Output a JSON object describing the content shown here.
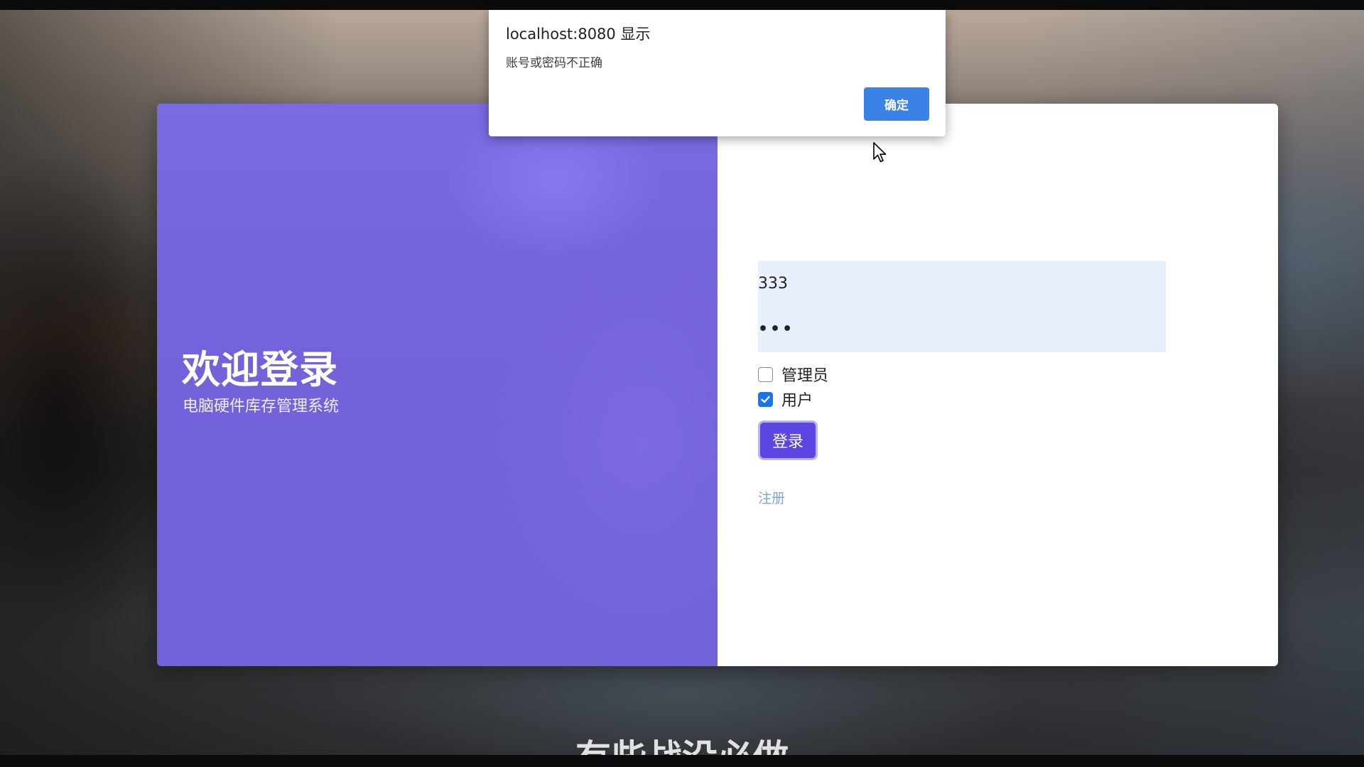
{
  "login": {
    "title": "欢迎登录",
    "subtitle": "电脑硬件库存管理系统",
    "username_value": "333",
    "password_value": "•••",
    "roles": [
      {
        "label": "管理员",
        "checked": false
      },
      {
        "label": "用户",
        "checked": true
      }
    ],
    "login_button": "登录",
    "register_link": "注册"
  },
  "alert": {
    "title": "localhost:8080 显示",
    "message": "账号或密码不正确",
    "ok_button": "确定"
  },
  "caption": {
    "text": "有些战没必做"
  },
  "colors": {
    "panel_purple": "#7363dc",
    "login_button": "#5b45e3",
    "alert_button": "#3b82e6",
    "input_fill": "#e8f0fe"
  },
  "icons": [
    "checkbox-checked-icon",
    "checkbox-unchecked-icon",
    "mouse-pointer-icon"
  ]
}
